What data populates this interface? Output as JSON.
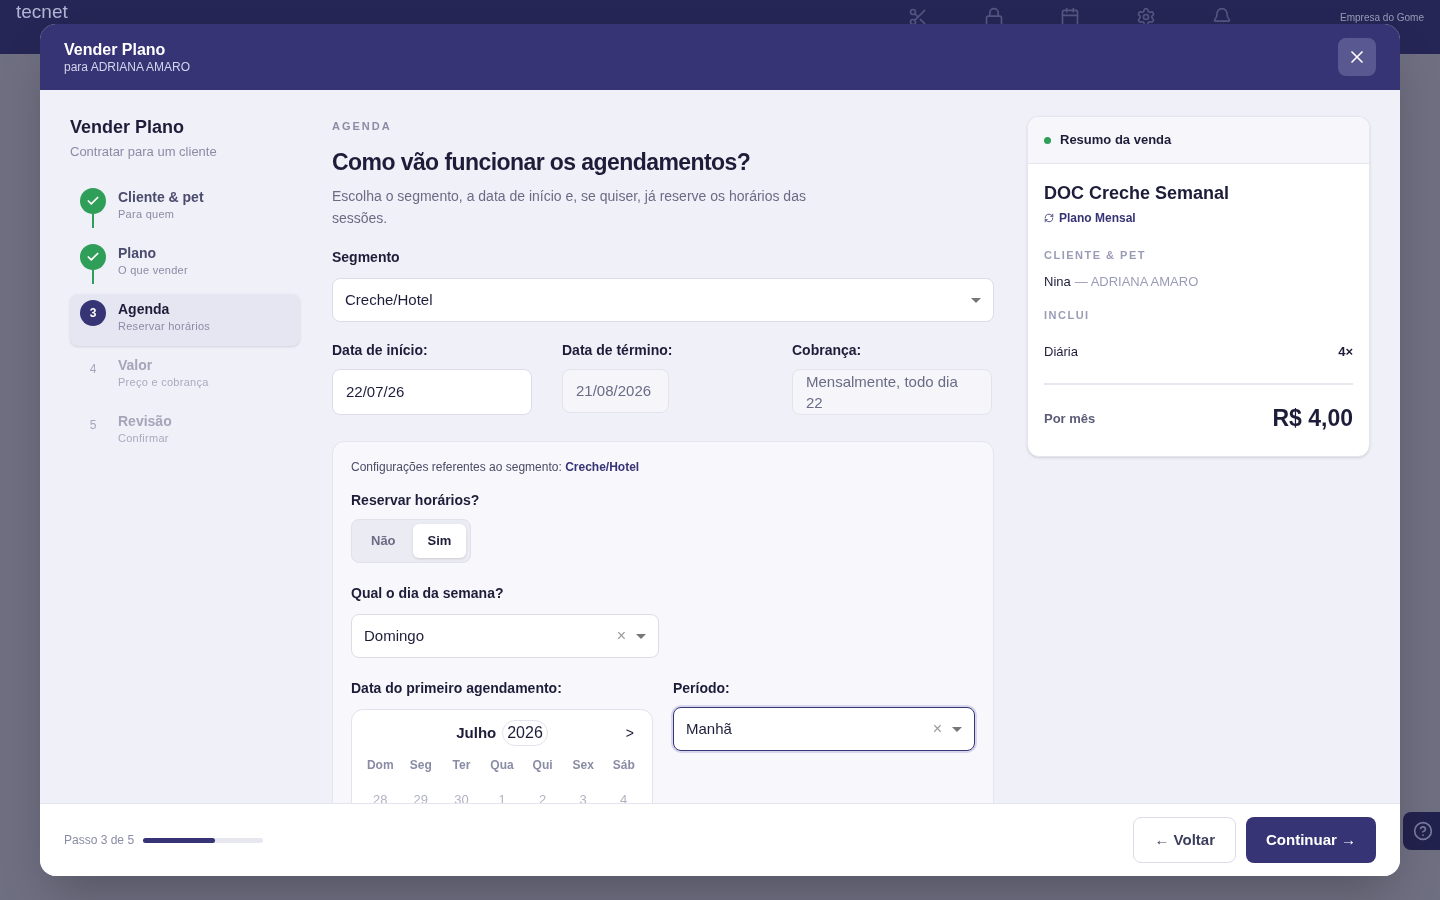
{
  "backdrop": {
    "logo": "tecnet",
    "company": "Empresa do Gome"
  },
  "modal": {
    "title": "Vender Plano",
    "subtitle": "para ADRIANA AMARO"
  },
  "stepper": {
    "title": "Vender Plano",
    "subtitle": "Contratar para um cliente",
    "steps": [
      {
        "label": "Cliente & pet",
        "hint": "Para quem",
        "completed": true,
        "selected": false
      },
      {
        "label": "Plano",
        "hint": "O que vender",
        "completed": true,
        "selected": false
      },
      {
        "number": "3",
        "label": "Agenda",
        "hint": "Reservar horários",
        "completed": false,
        "selected": true
      },
      {
        "number": "4",
        "label": "Valor",
        "hint": "Preço e cobrança",
        "completed": false,
        "selected": false
      },
      {
        "number": "5",
        "label": "Revisão",
        "hint": "Confirmar",
        "completed": false,
        "selected": false
      }
    ]
  },
  "main": {
    "eyebrow": "AGENDA",
    "heading": "Como vão funcionar os agendamentos?",
    "description": "Escolha o segmento, a data de início e, se quiser, já reserve os horários das sessões.",
    "segment": {
      "label": "Segmento",
      "value": "Creche/Hotel"
    },
    "start": {
      "label": "Data de início:",
      "value": "22/07/26"
    },
    "end": {
      "label": "Data de término:",
      "value": "21/08/2026"
    },
    "billing": {
      "label": "Cobrança:",
      "value": "Mensalmente, todo dia 22"
    },
    "config": {
      "intro": "Configurações referentes ao segmento: **Creche/Hotel**",
      "reserve_label": "Reservar horários?",
      "reserve_options": [
        {
          "label": "Não",
          "selected": false
        },
        {
          "label": "Sim",
          "selected": true
        }
      ],
      "weekday": {
        "label": "Qual o dia da semana?",
        "value": "Domingo",
        "clear": "×"
      },
      "first_date": {
        "label": "Data do primeiro agendamento:",
        "month": "Julho",
        "year": "2026",
        "next": ">",
        "weekdays": [
          "Dom",
          "Seg",
          "Ter",
          "Qua",
          "Qui",
          "Sex",
          "Sáb"
        ],
        "days": [
          "28",
          "29",
          "30",
          "1",
          "2",
          "3",
          "4"
        ]
      },
      "period": {
        "label": "Período:",
        "value": "Manhã",
        "clear": "×",
        "focused": true
      }
    }
  },
  "summary": {
    "title": "Resumo da venda",
    "plan": "DOC Creche Semanal",
    "plan_type": "Plano Mensal",
    "client_heading": "CLIENTE & PET",
    "pet": "Nina",
    "client": "— ADRIANA AMARO",
    "includes_heading": "INCLUI",
    "items": [
      {
        "name": "Diária",
        "qty": "4×"
      }
    ],
    "total_label": "Por mês",
    "total": "R$ 4,00"
  },
  "footer": {
    "progress_text": "Passo 3 de 5",
    "level": 0.6,
    "back": "← Voltar",
    "next": "Continuar →"
  }
}
